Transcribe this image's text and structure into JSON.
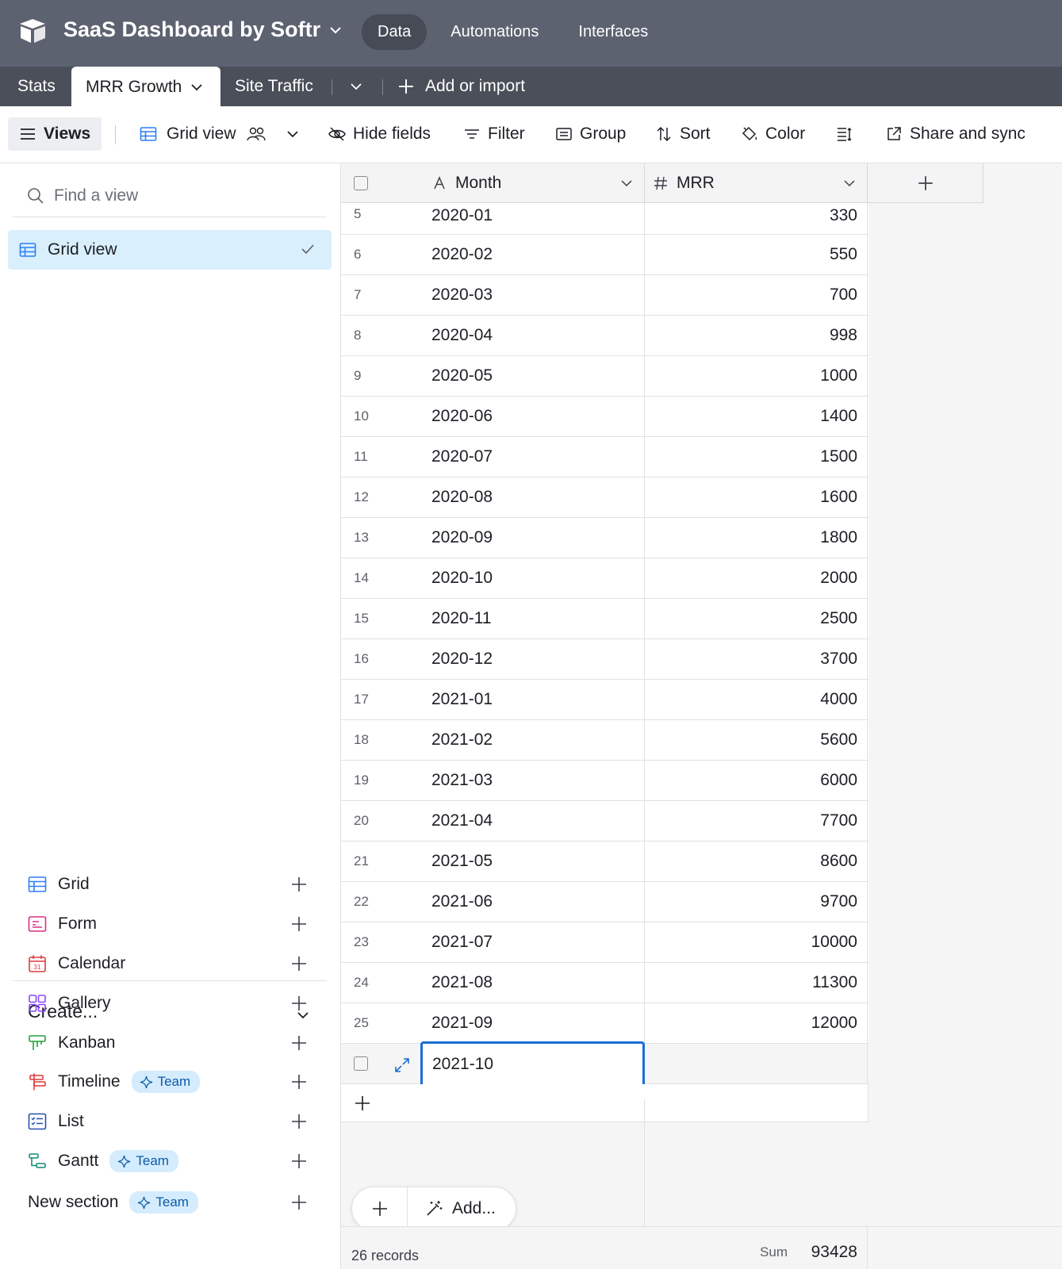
{
  "app": {
    "base_name": "SaaS Dashboard by Softr",
    "nav": [
      "Data",
      "Automations",
      "Interfaces"
    ],
    "active_nav": "Data"
  },
  "tables": {
    "tabs": [
      "Stats",
      "MRR Growth",
      "Site Traffic"
    ],
    "active": "MRR Growth",
    "add_label": "Add or import"
  },
  "toolbar": {
    "views": "Views",
    "view_name": "Grid view",
    "hide_fields": "Hide fields",
    "filter": "Filter",
    "group": "Group",
    "sort": "Sort",
    "color": "Color",
    "share": "Share and sync"
  },
  "sidebar": {
    "search_placeholder": "Find a view",
    "views": [
      "Grid view"
    ],
    "create_label": "Create...",
    "create_items": [
      {
        "label": "Grid",
        "icon": "grid-icon",
        "color": "#2d7ff9",
        "team": false
      },
      {
        "label": "Form",
        "icon": "form-icon",
        "color": "#dd2f85",
        "team": false
      },
      {
        "label": "Calendar",
        "icon": "calendar-icon",
        "color": "#dd3b3b",
        "team": false
      },
      {
        "label": "Gallery",
        "icon": "gallery-icon",
        "color": "#8b46ff",
        "team": false
      },
      {
        "label": "Kanban",
        "icon": "kanban-icon",
        "color": "#20a33a",
        "team": false
      },
      {
        "label": "Timeline",
        "icon": "timeline-icon",
        "color": "#dd3b3b",
        "team": true
      },
      {
        "label": "List",
        "icon": "list-icon",
        "color": "#2750ae",
        "team": false
      },
      {
        "label": "Gantt",
        "icon": "gantt-icon",
        "color": "#138a79",
        "team": true
      }
    ],
    "new_section": "New section",
    "team_badge": "Team"
  },
  "grid": {
    "columns": [
      "Month",
      "MRR"
    ],
    "rows": [
      {
        "n": "5",
        "month": "2020-01",
        "mrr": "330"
      },
      {
        "n": "6",
        "month": "2020-02",
        "mrr": "550"
      },
      {
        "n": "7",
        "month": "2020-03",
        "mrr": "700"
      },
      {
        "n": "8",
        "month": "2020-04",
        "mrr": "998"
      },
      {
        "n": "9",
        "month": "2020-05",
        "mrr": "1000"
      },
      {
        "n": "10",
        "month": "2020-06",
        "mrr": "1400"
      },
      {
        "n": "11",
        "month": "2020-07",
        "mrr": "1500"
      },
      {
        "n": "12",
        "month": "2020-08",
        "mrr": "1600"
      },
      {
        "n": "13",
        "month": "2020-09",
        "mrr": "1800"
      },
      {
        "n": "14",
        "month": "2020-10",
        "mrr": "2000"
      },
      {
        "n": "15",
        "month": "2020-11",
        "mrr": "2500"
      },
      {
        "n": "16",
        "month": "2020-12",
        "mrr": "3700"
      },
      {
        "n": "17",
        "month": "2021-01",
        "mrr": "4000"
      },
      {
        "n": "18",
        "month": "2021-02",
        "mrr": "5600"
      },
      {
        "n": "19",
        "month": "2021-03",
        "mrr": "6000"
      },
      {
        "n": "20",
        "month": "2021-04",
        "mrr": "7700"
      },
      {
        "n": "21",
        "month": "2021-05",
        "mrr": "8600"
      },
      {
        "n": "22",
        "month": "2021-06",
        "mrr": "9700"
      },
      {
        "n": "23",
        "month": "2021-07",
        "mrr": "10000"
      },
      {
        "n": "24",
        "month": "2021-08",
        "mrr": "11300"
      },
      {
        "n": "25",
        "month": "2021-09",
        "mrr": "12000"
      }
    ],
    "editing_value": "2021-10",
    "add_label": "Add...",
    "records_count": "26 records",
    "sum_label": "Sum",
    "sum_value": "93428"
  }
}
